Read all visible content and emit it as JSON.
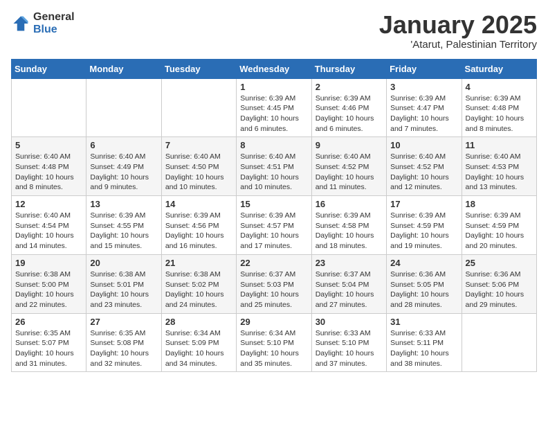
{
  "logo": {
    "general": "General",
    "blue": "Blue"
  },
  "header": {
    "title": "January 2025",
    "subtitle": "'Atarut, Palestinian Territory"
  },
  "weekdays": [
    "Sunday",
    "Monday",
    "Tuesday",
    "Wednesday",
    "Thursday",
    "Friday",
    "Saturday"
  ],
  "weeks": [
    [
      {
        "day": "",
        "info": ""
      },
      {
        "day": "",
        "info": ""
      },
      {
        "day": "",
        "info": ""
      },
      {
        "day": "1",
        "info": "Sunrise: 6:39 AM\nSunset: 4:45 PM\nDaylight: 10 hours\nand 6 minutes."
      },
      {
        "day": "2",
        "info": "Sunrise: 6:39 AM\nSunset: 4:46 PM\nDaylight: 10 hours\nand 6 minutes."
      },
      {
        "day": "3",
        "info": "Sunrise: 6:39 AM\nSunset: 4:47 PM\nDaylight: 10 hours\nand 7 minutes."
      },
      {
        "day": "4",
        "info": "Sunrise: 6:39 AM\nSunset: 4:48 PM\nDaylight: 10 hours\nand 8 minutes."
      }
    ],
    [
      {
        "day": "5",
        "info": "Sunrise: 6:40 AM\nSunset: 4:48 PM\nDaylight: 10 hours\nand 8 minutes."
      },
      {
        "day": "6",
        "info": "Sunrise: 6:40 AM\nSunset: 4:49 PM\nDaylight: 10 hours\nand 9 minutes."
      },
      {
        "day": "7",
        "info": "Sunrise: 6:40 AM\nSunset: 4:50 PM\nDaylight: 10 hours\nand 10 minutes."
      },
      {
        "day": "8",
        "info": "Sunrise: 6:40 AM\nSunset: 4:51 PM\nDaylight: 10 hours\nand 10 minutes."
      },
      {
        "day": "9",
        "info": "Sunrise: 6:40 AM\nSunset: 4:52 PM\nDaylight: 10 hours\nand 11 minutes."
      },
      {
        "day": "10",
        "info": "Sunrise: 6:40 AM\nSunset: 4:52 PM\nDaylight: 10 hours\nand 12 minutes."
      },
      {
        "day": "11",
        "info": "Sunrise: 6:40 AM\nSunset: 4:53 PM\nDaylight: 10 hours\nand 13 minutes."
      }
    ],
    [
      {
        "day": "12",
        "info": "Sunrise: 6:40 AM\nSunset: 4:54 PM\nDaylight: 10 hours\nand 14 minutes."
      },
      {
        "day": "13",
        "info": "Sunrise: 6:39 AM\nSunset: 4:55 PM\nDaylight: 10 hours\nand 15 minutes."
      },
      {
        "day": "14",
        "info": "Sunrise: 6:39 AM\nSunset: 4:56 PM\nDaylight: 10 hours\nand 16 minutes."
      },
      {
        "day": "15",
        "info": "Sunrise: 6:39 AM\nSunset: 4:57 PM\nDaylight: 10 hours\nand 17 minutes."
      },
      {
        "day": "16",
        "info": "Sunrise: 6:39 AM\nSunset: 4:58 PM\nDaylight: 10 hours\nand 18 minutes."
      },
      {
        "day": "17",
        "info": "Sunrise: 6:39 AM\nSunset: 4:59 PM\nDaylight: 10 hours\nand 19 minutes."
      },
      {
        "day": "18",
        "info": "Sunrise: 6:39 AM\nSunset: 4:59 PM\nDaylight: 10 hours\nand 20 minutes."
      }
    ],
    [
      {
        "day": "19",
        "info": "Sunrise: 6:38 AM\nSunset: 5:00 PM\nDaylight: 10 hours\nand 22 minutes."
      },
      {
        "day": "20",
        "info": "Sunrise: 6:38 AM\nSunset: 5:01 PM\nDaylight: 10 hours\nand 23 minutes."
      },
      {
        "day": "21",
        "info": "Sunrise: 6:38 AM\nSunset: 5:02 PM\nDaylight: 10 hours\nand 24 minutes."
      },
      {
        "day": "22",
        "info": "Sunrise: 6:37 AM\nSunset: 5:03 PM\nDaylight: 10 hours\nand 25 minutes."
      },
      {
        "day": "23",
        "info": "Sunrise: 6:37 AM\nSunset: 5:04 PM\nDaylight: 10 hours\nand 27 minutes."
      },
      {
        "day": "24",
        "info": "Sunrise: 6:36 AM\nSunset: 5:05 PM\nDaylight: 10 hours\nand 28 minutes."
      },
      {
        "day": "25",
        "info": "Sunrise: 6:36 AM\nSunset: 5:06 PM\nDaylight: 10 hours\nand 29 minutes."
      }
    ],
    [
      {
        "day": "26",
        "info": "Sunrise: 6:35 AM\nSunset: 5:07 PM\nDaylight: 10 hours\nand 31 minutes."
      },
      {
        "day": "27",
        "info": "Sunrise: 6:35 AM\nSunset: 5:08 PM\nDaylight: 10 hours\nand 32 minutes."
      },
      {
        "day": "28",
        "info": "Sunrise: 6:34 AM\nSunset: 5:09 PM\nDaylight: 10 hours\nand 34 minutes."
      },
      {
        "day": "29",
        "info": "Sunrise: 6:34 AM\nSunset: 5:10 PM\nDaylight: 10 hours\nand 35 minutes."
      },
      {
        "day": "30",
        "info": "Sunrise: 6:33 AM\nSunset: 5:10 PM\nDaylight: 10 hours\nand 37 minutes."
      },
      {
        "day": "31",
        "info": "Sunrise: 6:33 AM\nSunset: 5:11 PM\nDaylight: 10 hours\nand 38 minutes."
      },
      {
        "day": "",
        "info": ""
      }
    ]
  ]
}
